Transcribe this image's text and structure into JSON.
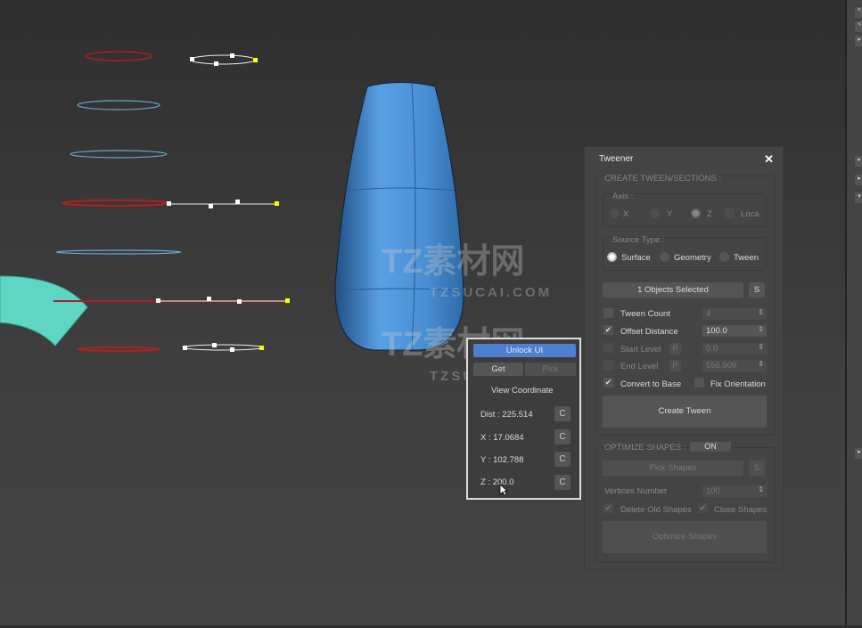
{
  "watermark": {
    "logo": "TZ素材网",
    "url": "TZSUCAI.COM"
  },
  "tweener": {
    "title": "Tweener",
    "create_section": "CREATE TWEEN/SECTIONS :",
    "axis": {
      "label": "Axis :",
      "options": [
        "X",
        "Y",
        "Z",
        "Loca"
      ],
      "selected": "Z"
    },
    "source_type": {
      "label": "Source Type :",
      "options": [
        "Surface",
        "Geometry",
        "Tween"
      ],
      "selected": "Surface"
    },
    "objects_selected": "1 Objects Selected",
    "s_label": "S",
    "p_label": "P",
    "tween_count": {
      "label": "Tween Count",
      "value": "4",
      "checked": false
    },
    "offset_distance": {
      "label": "Offset Distance",
      "value": "100.0",
      "checked": true
    },
    "start_level": {
      "label": "Start Level",
      "value": "0.0"
    },
    "end_level": {
      "label": "End Level",
      "value": "556.909"
    },
    "convert_to_base": {
      "label": "Convert to Base",
      "checked": true
    },
    "fix_orientation": {
      "label": "Fix Orientation",
      "checked": false
    },
    "create_tween": "Create Tween",
    "optimize_section": "OPTIMIZE SHAPES :",
    "optimize_toggle": "ON",
    "pick_shapes": "Pick Shapes",
    "vertices_number": {
      "label": "Vertices Number",
      "value": "100"
    },
    "delete_old_shapes": "Delete Old Shapes",
    "close_shapes": "Close Shapes",
    "optimize_shapes": "Optimize Shapes"
  },
  "coord_panel": {
    "unlock": "Unlock UI",
    "get": "Get",
    "pick": "Pick",
    "view_coordinate": "View Coordinate",
    "rows": [
      {
        "label": "Dist : 225.514"
      },
      {
        "label": "X : 17.0684"
      },
      {
        "label": "Y : 102.788"
      },
      {
        "label": "Z : 200.0"
      }
    ],
    "c_label": "C"
  },
  "colors": {
    "vase": "#4a8fd4",
    "accent": "#4f7fd0",
    "teal": "#5fd6c4"
  }
}
